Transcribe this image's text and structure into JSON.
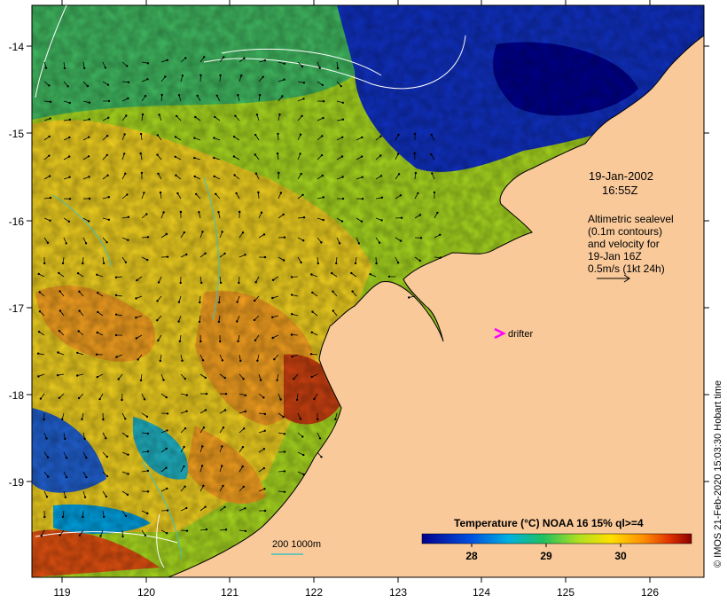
{
  "map": {
    "date_line1": "19-Jan-2002",
    "date_line2": "16:55Z",
    "legend_lines": [
      "Altimetric sealevel",
      "(0.1m contours)",
      "and velocity for",
      "19-Jan 16Z",
      "0.5m/s (1kt 24h)"
    ],
    "drifter_label": "drifter",
    "bathymetry_label": "200  1000m",
    "credit": "© IMOS 21-Feb-2020 15:03:30 Hobart time",
    "x_ticks": [
      "119",
      "120",
      "121",
      "122",
      "123",
      "124",
      "125",
      "126"
    ],
    "y_ticks": [
      "-14",
      "-15",
      "-16",
      "-17",
      "-18",
      "-19"
    ]
  },
  "colorbar": {
    "title": "Temperature (°C) NOAA 16 15% ql>=4",
    "ticks": [
      "28",
      "29",
      "30"
    ]
  },
  "colors": {
    "land": "#f9c99a",
    "drifter": "#ff00ff",
    "contour": "#ffffff",
    "bathymetry": "#40c0c0"
  }
}
